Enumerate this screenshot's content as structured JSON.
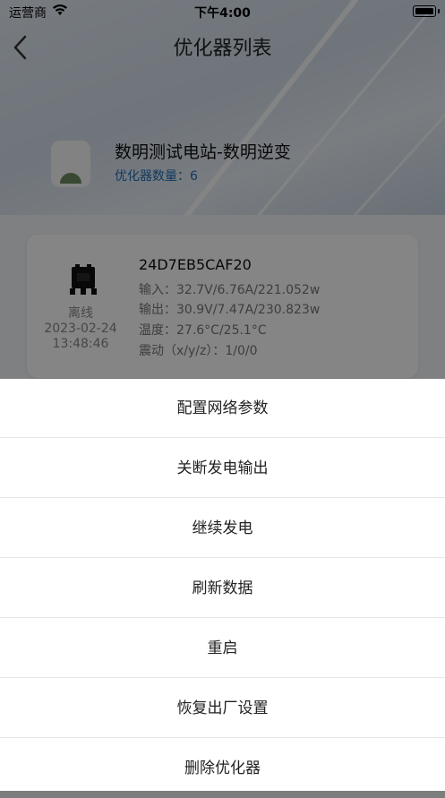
{
  "status_bar": {
    "carrier": "运营商",
    "time": "下午4:00"
  },
  "nav": {
    "title": "优化器列表"
  },
  "station": {
    "name": "数明测试电站-数明逆变",
    "count_label": "优化器数量：6"
  },
  "device": {
    "status": "离线",
    "date": "2023-02-24",
    "time": "13:48:46",
    "id": "24D7EB5CAF20",
    "input": "输入：32.7V/6.76A/221.052w",
    "output": "输出：30.9V/7.47A/230.823w",
    "temperature": "温度：27.6°C/25.1°C",
    "vibration": "震动（x/y/z）：1/0/0"
  },
  "action_sheet": {
    "items": [
      {
        "label": "配置网络参数"
      },
      {
        "label": "关断发电输出"
      },
      {
        "label": "继续发电"
      },
      {
        "label": "刷新数据"
      },
      {
        "label": "重启"
      },
      {
        "label": "恢复出厂设置"
      },
      {
        "label": "删除优化器"
      }
    ]
  },
  "colors": {
    "accent": "#1f6fb8",
    "overlay": "rgba(0,0,0,0.48)"
  }
}
